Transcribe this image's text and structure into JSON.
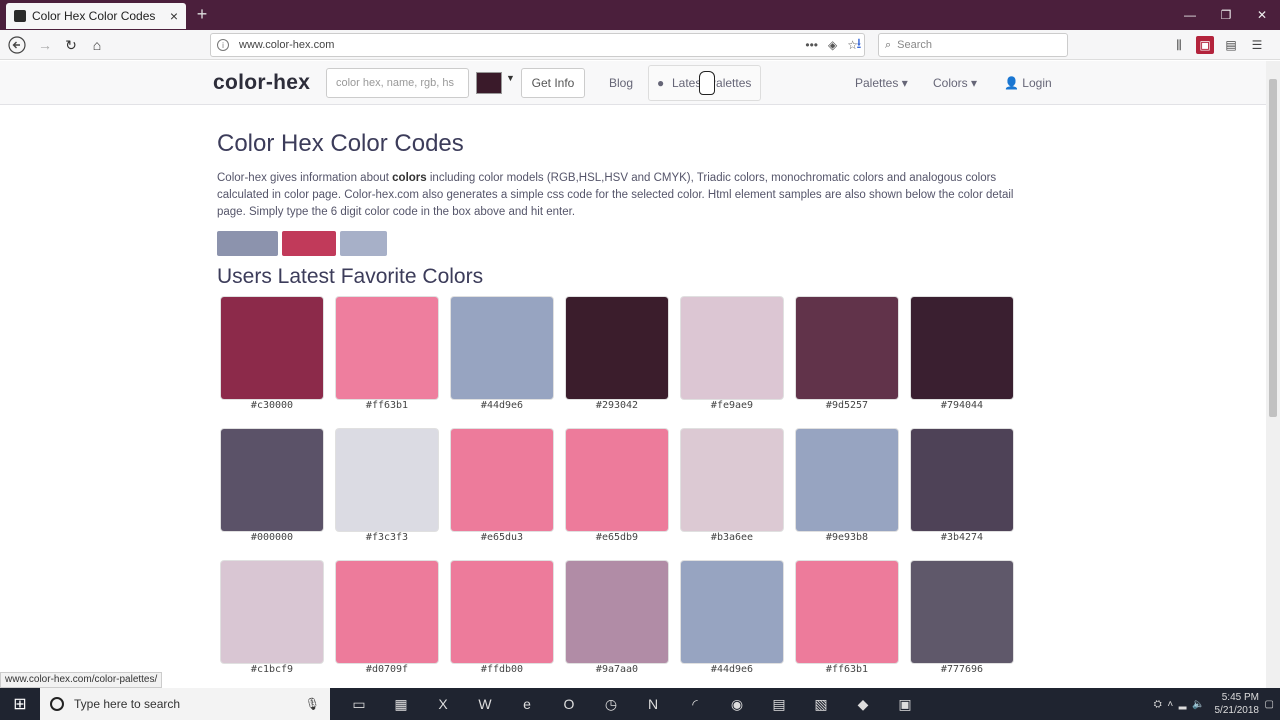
{
  "browser": {
    "tab_title": "Color Hex Color Codes",
    "url": "www.color-hex.com",
    "search_placeholder": "Search",
    "status_url": "www.color-hex.com/color-palettes/"
  },
  "site": {
    "logo": "color-hex",
    "input_placeholder": "color hex, name, rgb, hs",
    "get_info": "Get Info",
    "blog": "Blog",
    "latest_palettes": "Latest Palettes",
    "palettes": "Palettes",
    "colors": "Colors",
    "login": "Login"
  },
  "main": {
    "title": "Color Hex Color Codes",
    "intro_pre": "Color-hex gives information about ",
    "intro_bold": "colors",
    "intro_post": " including color models (RGB,HSL,HSV and CMYK), Triadic colors, monochromatic colors and analogous colors calculated in color page. Color-hex.com also generates a simple css code for the selected color. Html element samples are also shown below the color detail page. Simply type the 6 digit color code in the box above and hit enter.",
    "favorites_title": "Users Latest Favorite Colors"
  },
  "swatches": [
    {
      "code": "#c30000",
      "color": "#8c2a4a"
    },
    {
      "code": "#ff63b1",
      "color": "#ee7e9e"
    },
    {
      "code": "#44d9e6",
      "color": "#97a4c1"
    },
    {
      "code": "#293042",
      "color": "#3b1d2c"
    },
    {
      "code": "#fe9ae9",
      "color": "#dcc6d3"
    },
    {
      "code": "#9d5257",
      "color": "#61334a"
    },
    {
      "code": "#794044",
      "color": "#3a1f30"
    },
    {
      "code": "#000000",
      "color": "#5b5268"
    },
    {
      "code": "#f3c3f3",
      "color": "#dbdbe3"
    },
    {
      "code": "#e65du3",
      "color": "#ed7b9b"
    },
    {
      "code": "#e65db9",
      "color": "#ed7b9b"
    },
    {
      "code": "#b3a6ee",
      "color": "#dcc9d3"
    },
    {
      "code": "#9e93b8",
      "color": "#97a4c1"
    },
    {
      "code": "#3b4274",
      "color": "#4e4257"
    },
    {
      "code": "#c1bcf9",
      "color": "#d9c6d3"
    },
    {
      "code": "#d0709f",
      "color": "#ed7b9b"
    },
    {
      "code": "#ffdb00",
      "color": "#ed7b9b"
    },
    {
      "code": "#9a7aa0",
      "color": "#b18ca6"
    },
    {
      "code": "#44d9e6",
      "color": "#97a4c1"
    },
    {
      "code": "#ff63b1",
      "color": "#ed7b9b"
    },
    {
      "code": "#777696",
      "color": "#5f586a"
    }
  ],
  "taskbar": {
    "search_placeholder": "Type here to search",
    "time": "5:45 PM",
    "date": "5/21/2018"
  },
  "accent": "#4b1f3c"
}
